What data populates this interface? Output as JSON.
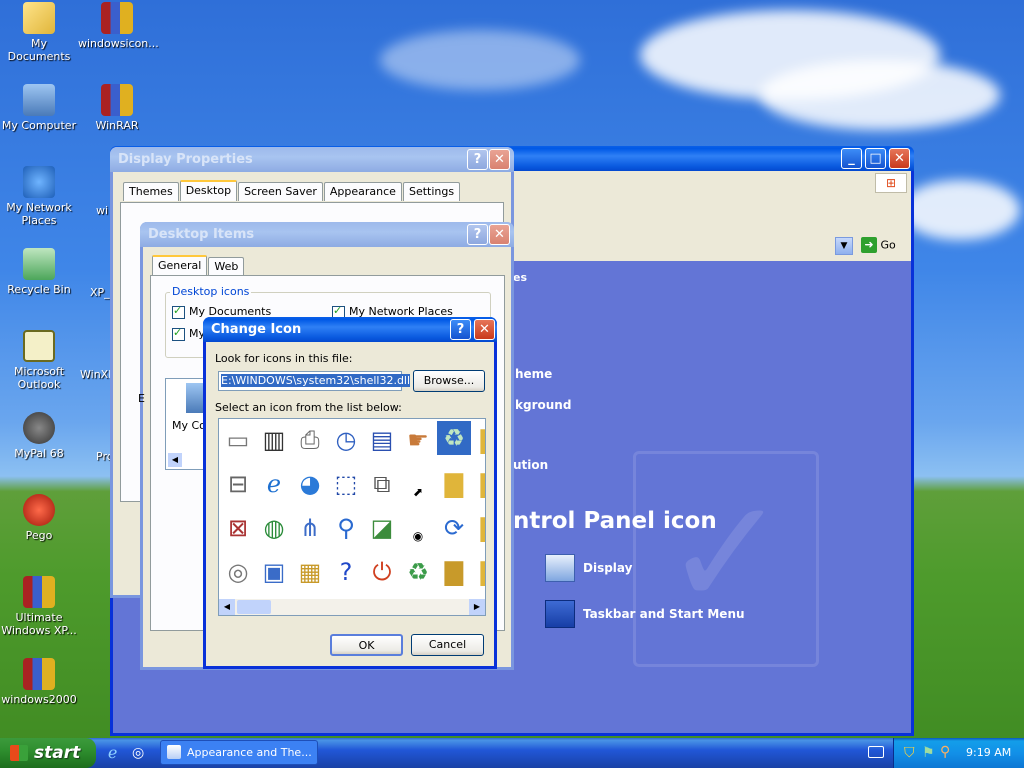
{
  "desktop": {
    "icons": [
      {
        "label": "My Documents"
      },
      {
        "label": "windowsicon..."
      },
      {
        "label": "My Computer"
      },
      {
        "label": "WinRAR"
      },
      {
        "label": "My Network Places"
      },
      {
        "label": "Recycle Bin"
      },
      {
        "label": "Microsoft Outlook"
      },
      {
        "label": "MyPal 68"
      },
      {
        "label": "Pego"
      },
      {
        "label": "Ultimate Windows XP..."
      },
      {
        "label": "windows2000"
      }
    ],
    "partial_labels": [
      "wi",
      "XP_",
      "WinXP",
      "Pro"
    ]
  },
  "control_panel": {
    "go_label": "Go",
    "heading_fragments": [
      "es",
      "heme",
      "kground",
      "ution"
    ],
    "pick_text": "ntrol Panel icon",
    "links": [
      {
        "label": "Display",
        "icon": "display-icon"
      },
      {
        "label": "Taskbar and Start Menu",
        "icon": "taskbar-icon"
      }
    ]
  },
  "display_properties": {
    "title": "Display Properties",
    "tabs": [
      "Themes",
      "Desktop",
      "Screen Saver",
      "Appearance",
      "Settings"
    ],
    "active_tab": "Desktop"
  },
  "desktop_items": {
    "title": "Desktop Items",
    "tabs": [
      "General",
      "Web"
    ],
    "group_label": "Desktop icons",
    "checkboxes": [
      "My Documents",
      "My Network Places",
      "My"
    ],
    "preview_label": "My Co",
    "partial_e": "E"
  },
  "change_icon": {
    "title": "Change Icon",
    "look_label": "Look for icons in this file:",
    "file_path": "E:\\WINDOWS\\system32\\shell32.dll",
    "browse_label": "Browse...",
    "select_label": "Select an icon from the list below:",
    "ok_label": "OK",
    "cancel_label": "Cancel"
  },
  "taskbar": {
    "start_label": "start",
    "task_label": "Appearance and The...",
    "clock": "9:19 AM"
  },
  "colors": {
    "titlebar_active": "#0058e6",
    "window_bg": "#ece9d8",
    "cp_bg": "#6375d6"
  }
}
